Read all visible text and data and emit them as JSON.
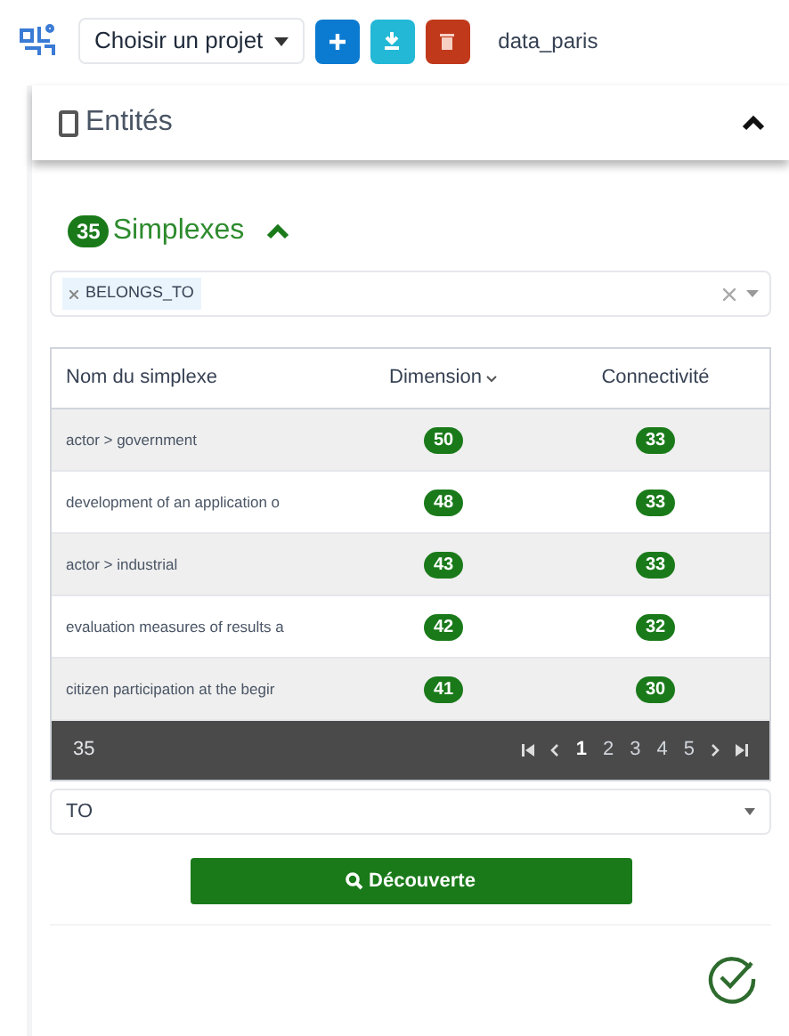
{
  "toolbar": {
    "project_select": "Choisir un projet",
    "project_name": "data_paris"
  },
  "entities_panel": {
    "title": "Entités",
    "expanded": true
  },
  "simplexes": {
    "count": "35",
    "title": "Simplexes",
    "expanded": true,
    "filter": {
      "tags": [
        "BELONGS_TO"
      ]
    },
    "table": {
      "columns": [
        "Nom du simplexe",
        "Dimension",
        "Connectivité"
      ],
      "rows": [
        {
          "name": "actor > government",
          "dimension": "50",
          "connectivity": "33"
        },
        {
          "name": "development of an application o",
          "dimension": "48",
          "connectivity": "33"
        },
        {
          "name": "actor > industrial",
          "dimension": "43",
          "connectivity": "33"
        },
        {
          "name": "evaluation measures of results a",
          "dimension": "42",
          "connectivity": "32"
        },
        {
          "name": "citizen participation at the begir",
          "dimension": "41",
          "connectivity": "30"
        }
      ],
      "footer": {
        "total": "35",
        "pages": [
          {
            "label": "1",
            "selected": true
          },
          {
            "label": "2",
            "selected": false
          },
          {
            "label": "3",
            "selected": false
          },
          {
            "label": "4",
            "selected": false
          },
          {
            "label": "5",
            "selected": false
          }
        ]
      }
    },
    "relation_select": "TO",
    "discover_button": "Découverte"
  }
}
